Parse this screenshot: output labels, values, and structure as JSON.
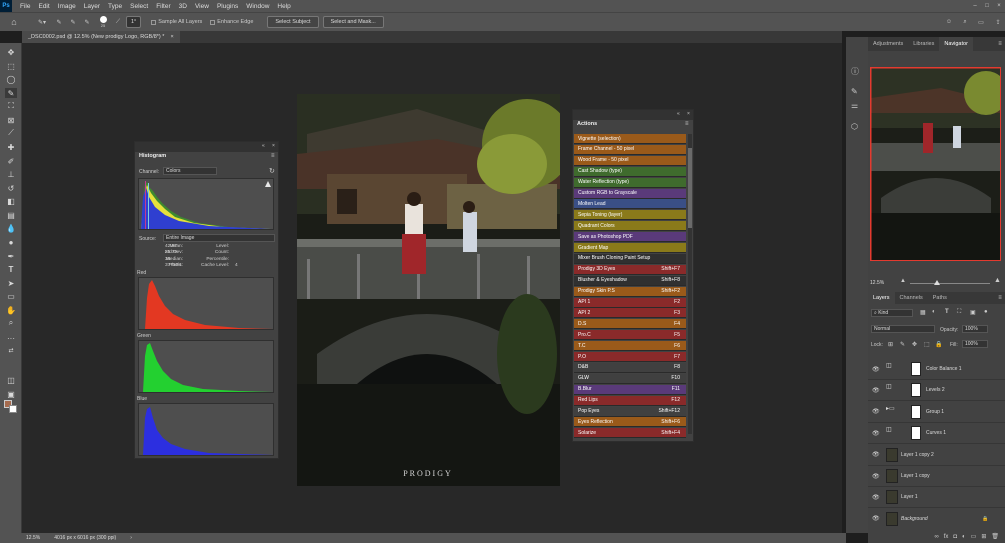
{
  "app": {
    "logo": "Ps"
  },
  "menu": [
    "File",
    "Edit",
    "Image",
    "Layer",
    "Type",
    "Select",
    "Filter",
    "3D",
    "View",
    "Plugins",
    "Window",
    "Help"
  ],
  "options": {
    "brush_size": "25",
    "angle": "1°",
    "sample_all_layers": "Sample All Layers",
    "enhance_edge": "Enhance Edge",
    "select_subject": "Select Subject",
    "select_and_mask": "Select and Mask..."
  },
  "document_tab": {
    "title": "_DSC0002.psd @ 12.5% (New prodigy Logo, RGB/8*) *",
    "close": "×"
  },
  "histogram": {
    "title": "Histogram",
    "channel_label": "Channel:",
    "channel_value": "Colors",
    "source_label": "Source:",
    "source_value": "Entire Image",
    "stats": {
      "mean_label": "Mean:",
      "mean": "42.97",
      "stddev_label": "Std Dev:",
      "stddev": "25.79",
      "median_label": "Median:",
      "median": "36",
      "pixels_label": "Pixels:",
      "pixels": "377504",
      "level_label": "Level:",
      "count_label": "Count:",
      "percentile_label": "Percentile:",
      "cache_label": "Cache Level:",
      "cache": "4"
    },
    "channels": [
      "Red",
      "Green",
      "Blue"
    ]
  },
  "actions": {
    "title": "Actions",
    "items": [
      {
        "label": "Vignette (selection)",
        "key": "",
        "color": "#9a5a1a"
      },
      {
        "label": "Frame Channel - 50 pixel",
        "key": "",
        "color": "#9a5a1a"
      },
      {
        "label": "Wood Frame - 50 pixel",
        "key": "",
        "color": "#9a5a1a"
      },
      {
        "label": "Cast Shadow (type)",
        "key": "",
        "color": "#3f6b2d"
      },
      {
        "label": "Water Reflection (type)",
        "key": "",
        "color": "#3f6b2d"
      },
      {
        "label": "Custom RGB to Grayscale",
        "key": "",
        "color": "#5a3a7a"
      },
      {
        "label": "Molten Lead",
        "key": "",
        "color": "#3a4f86"
      },
      {
        "label": "Sepia Toning (layer)",
        "key": "",
        "color": "#8a7a1a"
      },
      {
        "label": "Quadrant Colors",
        "key": "",
        "color": "#8a7a1a"
      },
      {
        "label": "Save as Photoshop PDF",
        "key": "",
        "color": "#5a3a7a"
      },
      {
        "label": "Gradient Map",
        "key": "",
        "color": "#8a7a1a"
      },
      {
        "label": "Mixer Brush Cloning Paint Setup",
        "key": "",
        "color": "#303030"
      },
      {
        "label": "Prodigy 3D Eyes",
        "key": "Shift+F7",
        "color": "#8a2a2a"
      },
      {
        "label": "Blusher & Eyeshadow",
        "key": "Shift+F8",
        "color": "#303030"
      },
      {
        "label": "Prodigy Skin P.S",
        "key": "Shift+F2",
        "color": "#9a5a1a"
      },
      {
        "label": "API 1",
        "key": "F2",
        "color": "#8a2a2a"
      },
      {
        "label": "API 2",
        "key": "F3",
        "color": "#8a2a2a"
      },
      {
        "label": "D.S",
        "key": "F4",
        "color": "#9a5a1a"
      },
      {
        "label": "Pro.C",
        "key": "F5",
        "color": "#8a2a2a"
      },
      {
        "label": "T.C",
        "key": "F6",
        "color": "#9a5a1a"
      },
      {
        "label": "P.O",
        "key": "F7",
        "color": "#8a2a2a"
      },
      {
        "label": "D&B",
        "key": "F8",
        "color": "#404040"
      },
      {
        "label": "GLW",
        "key": "F10",
        "color": "#404040"
      },
      {
        "label": "B.Blur",
        "key": "F11",
        "color": "#5a3a7a"
      },
      {
        "label": "Red Lips",
        "key": "F12",
        "color": "#8a2a2a"
      },
      {
        "label": "Pop Eyes",
        "key": "Shift+F12",
        "color": "#404040"
      },
      {
        "label": "Eyes Reflection",
        "key": "Shift+F6",
        "color": "#9a5a1a"
      },
      {
        "label": "Solarize",
        "key": "Shift+F4",
        "color": "#8a2a2a"
      }
    ]
  },
  "right_tabs": [
    "Adjustments",
    "Libraries",
    "Navigator"
  ],
  "navigator": {
    "zoom": "12.5%"
  },
  "layers_tabs": [
    "Layers",
    "Channels",
    "Paths"
  ],
  "layers": {
    "kind": "Kind",
    "blend_mode": "Normal",
    "opacity_label": "Opacity:",
    "opacity": "100%",
    "lock_label": "Lock:",
    "fill_label": "Fill:",
    "fill": "100%",
    "items": [
      {
        "name": "Color Balance 1"
      },
      {
        "name": "Levels 2"
      },
      {
        "name": "Group 1"
      },
      {
        "name": "Curves 1"
      },
      {
        "name": "Layer 1 copy 2"
      },
      {
        "name": "Layer 1 copy"
      },
      {
        "name": "Layer 1"
      },
      {
        "name": "Background"
      }
    ]
  },
  "status": {
    "zoom": "12.5%",
    "doc_size": "4016 px x 6016 px (300 ppi)"
  },
  "watermark": "PRODIGY"
}
